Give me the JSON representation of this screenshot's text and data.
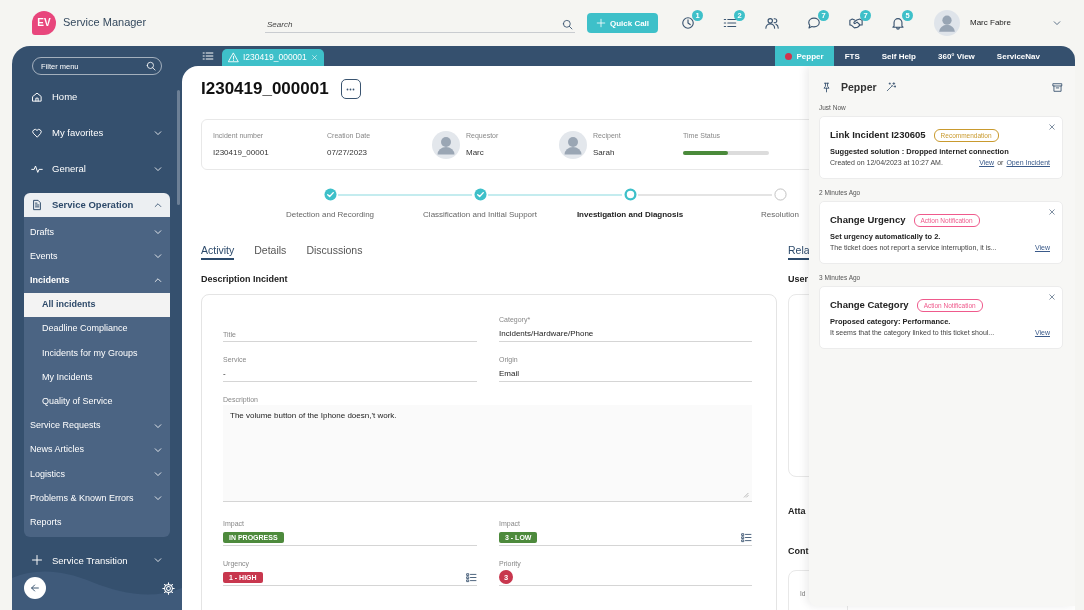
{
  "header": {
    "logo": "EV",
    "app_name": "Service Manager",
    "search": {
      "placeholder": "Search"
    },
    "quick_call": "Quick Call",
    "toolbar_start": [
      {
        "badge": "1"
      },
      {
        "badge": "2"
      }
    ],
    "toolbar_end": [
      {
        "badge": "7"
      },
      {
        "badge": "7"
      },
      {
        "badge": "5"
      }
    ],
    "user": {
      "name": "Marc Fabre"
    }
  },
  "sidebar": {
    "filter": {
      "placeholder": "Filter menu"
    },
    "items": [
      {
        "label": "Home",
        "kind": "link",
        "expanded": false,
        "selected": false
      },
      {
        "label": "My favorites",
        "kind": "group",
        "expanded": false,
        "selected": false
      },
      {
        "label": "General",
        "kind": "group",
        "expanded": false,
        "selected": false
      },
      {
        "label": "Service Operation",
        "kind": "group",
        "expanded": true,
        "selected": false,
        "children": [
          {
            "label": "Drafts",
            "kind": "group",
            "expanded": false,
            "selected": false
          },
          {
            "label": "Events",
            "kind": "group",
            "expanded": false,
            "selected": false
          },
          {
            "label": "Incidents",
            "kind": "group",
            "expanded": true,
            "selected": false,
            "children": [
              {
                "label": "All incidents",
                "selected": true
              },
              {
                "label": "Deadline Compliance",
                "selected": false
              },
              {
                "label": "Incidents for my Groups",
                "selected": false
              },
              {
                "label": "My Incidents",
                "selected": false
              },
              {
                "label": "Quality of Service",
                "selected": false
              }
            ]
          },
          {
            "label": "Service Requests",
            "kind": "group",
            "expanded": false,
            "selected": false
          },
          {
            "label": "News Articles",
            "kind": "group",
            "expanded": false,
            "selected": false
          },
          {
            "label": "Logistics",
            "kind": "group",
            "expanded": false,
            "selected": false
          },
          {
            "label": "Problems & Known Errors",
            "kind": "group",
            "expanded": false,
            "selected": false
          },
          {
            "label": "Reports",
            "kind": "link",
            "expanded": false,
            "selected": false
          }
        ]
      },
      {
        "label": "Service Transition",
        "kind": "group",
        "expanded": false,
        "selected": false
      }
    ]
  },
  "record_tabs": [
    {
      "label": "I230419_000001",
      "selected": true
    }
  ],
  "panel_tabs": [
    {
      "label": "Pepper",
      "selected": true,
      "dot": true
    },
    {
      "label": "FTS",
      "selected": false,
      "dot": false
    },
    {
      "label": "Self Help",
      "selected": false,
      "dot": false
    },
    {
      "label": "360° View",
      "selected": false,
      "dot": false
    },
    {
      "label": "ServiceNav",
      "selected": false,
      "dot": false
    }
  ],
  "incident": {
    "title": "I230419_000001",
    "summary": [
      {
        "kind": "text",
        "label": "Incident number",
        "value": "I230419_00001"
      },
      {
        "kind": "text",
        "label": "Creation Date",
        "value": "07/27/2023"
      },
      {
        "kind": "person",
        "label": "Requestor",
        "value": "Marc"
      },
      {
        "kind": "person",
        "label": "Recipent",
        "value": "Sarah"
      }
    ],
    "time_status": {
      "label": "Time Status",
      "level": 0.52
    },
    "steps": [
      {
        "label": "Detection and Recording",
        "completed": true,
        "current": false
      },
      {
        "label": "Classification and Initial Support",
        "completed": true,
        "current": false
      },
      {
        "label": "Investigation and Diagnosis",
        "completed": false,
        "current": true
      },
      {
        "label": "Resolution",
        "completed": false,
        "current": false
      }
    ],
    "tabs": [
      {
        "label": "Activity",
        "selected": true
      },
      {
        "label": "Details",
        "selected": false
      },
      {
        "label": "Discussions",
        "selected": false
      }
    ],
    "section_title": "Description Incident",
    "rows": [
      {
        "fields": [
          {
            "kind": "text",
            "placeholder": "Title"
          },
          {
            "kind": "text",
            "label": "Category*",
            "value": "Incidents/Hardware/Phone"
          }
        ]
      },
      {
        "fields": [
          {
            "kind": "text",
            "label": "Service",
            "value": "-"
          },
          {
            "kind": "text",
            "label": "Origin",
            "value": "Email"
          }
        ]
      },
      {
        "fields": [
          {
            "kind": "textarea",
            "label": "Description",
            "value": "The volume button of the Iphone doesn,'t work."
          }
        ]
      },
      {
        "fields": [
          {
            "kind": "badge",
            "label": "Impact",
            "value": "IN PROGRESS",
            "color": "#4d8a3c",
            "picker": false
          },
          {
            "kind": "badge",
            "label": "Impact",
            "value": "3 - LOW",
            "color": "#4d8a3c",
            "picker": true
          }
        ]
      },
      {
        "fields": [
          {
            "kind": "badge",
            "label": "Urgency",
            "value": "1 - HIGH",
            "color": "#c8374e",
            "picker": true
          },
          {
            "kind": "dot",
            "label": "Priority",
            "value": "3",
            "color": "#c8374e"
          }
        ]
      }
    ]
  },
  "related": {
    "tabs": [
      {
        "label": "Rela",
        "selected": true
      }
    ],
    "headings": [
      "User",
      "Atta",
      "Cont"
    ],
    "table_header": "Id"
  },
  "pepper": {
    "title": "Pepper",
    "notifications": [
      {
        "time": "Just Now",
        "title": "Link Incident I230605",
        "tag": {
          "label": "Recommendation",
          "color": "#c99a2e"
        },
        "summary": "Suggested solution : Dropped internet connection",
        "detail": "Created on 12/04/2023 at 10:27 AM.",
        "actions": [
          {
            "kind": "link",
            "text": "View"
          },
          {
            "kind": "text",
            "text": "or"
          },
          {
            "kind": "link",
            "text": "Open Incident"
          }
        ]
      },
      {
        "time": "2 Minutes Ago",
        "title": "Change Urgency",
        "tag": {
          "label": "Action Notification",
          "color": "#ef5a8c"
        },
        "summary": "Set urgency automatically to 2.",
        "detail": "The ticket does not report a service interruption, it is...",
        "actions": [
          {
            "kind": "link",
            "text": "View"
          }
        ]
      },
      {
        "time": "3 Minutes Ago",
        "title": "Change Category",
        "tag": {
          "label": "Action Notification",
          "color": "#ef5a8c"
        },
        "summary": "Proposed category: Performance.",
        "detail": "It seems that the category linked to this ticket shoul...",
        "actions": [
          {
            "kind": "link",
            "text": "View"
          }
        ]
      }
    ]
  }
}
